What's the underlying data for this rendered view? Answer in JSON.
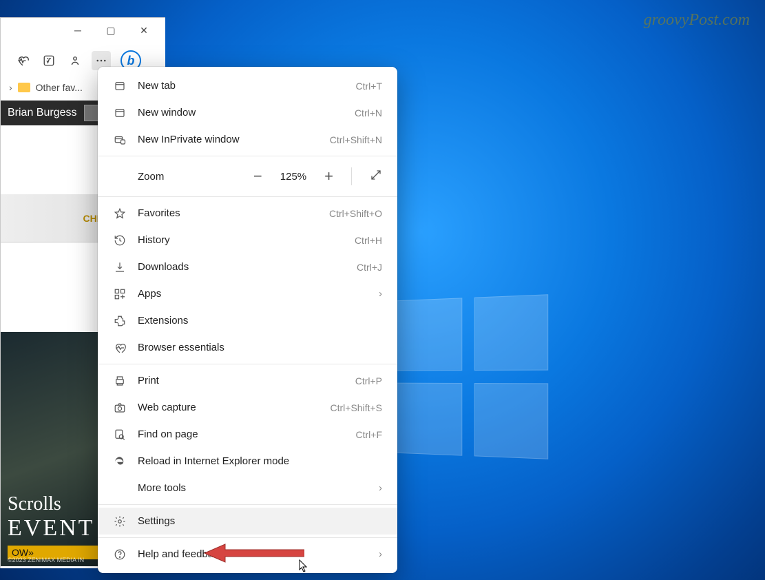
{
  "watermark": "groovyPost.com",
  "browser": {
    "favorites_label": "Other fav...",
    "author": "Brian Burgess",
    "ad_brand": "CHEVROLET",
    "ad_title": "Scrolls",
    "ad_event": "EVENT",
    "ad_cta": "OW»",
    "ad_copy": "©2023 ZENIMAX MEDIA IN"
  },
  "menu": {
    "new_tab": {
      "label": "New tab",
      "shortcut": "Ctrl+T"
    },
    "new_window": {
      "label": "New window",
      "shortcut": "Ctrl+N"
    },
    "new_inprivate": {
      "label": "New InPrivate window",
      "shortcut": "Ctrl+Shift+N"
    },
    "zoom_label": "Zoom",
    "zoom_value": "125%",
    "favorites": {
      "label": "Favorites",
      "shortcut": "Ctrl+Shift+O"
    },
    "history": {
      "label": "History",
      "shortcut": "Ctrl+H"
    },
    "downloads": {
      "label": "Downloads",
      "shortcut": "Ctrl+J"
    },
    "apps": {
      "label": "Apps"
    },
    "extensions": {
      "label": "Extensions"
    },
    "essentials": {
      "label": "Browser essentials"
    },
    "print": {
      "label": "Print",
      "shortcut": "Ctrl+P"
    },
    "web_capture": {
      "label": "Web capture",
      "shortcut": "Ctrl+Shift+S"
    },
    "find": {
      "label": "Find on page",
      "shortcut": "Ctrl+F"
    },
    "ie_mode": {
      "label": "Reload in Internet Explorer mode"
    },
    "more_tools": {
      "label": "More tools"
    },
    "settings": {
      "label": "Settings"
    },
    "help": {
      "label": "Help and feedback"
    }
  }
}
